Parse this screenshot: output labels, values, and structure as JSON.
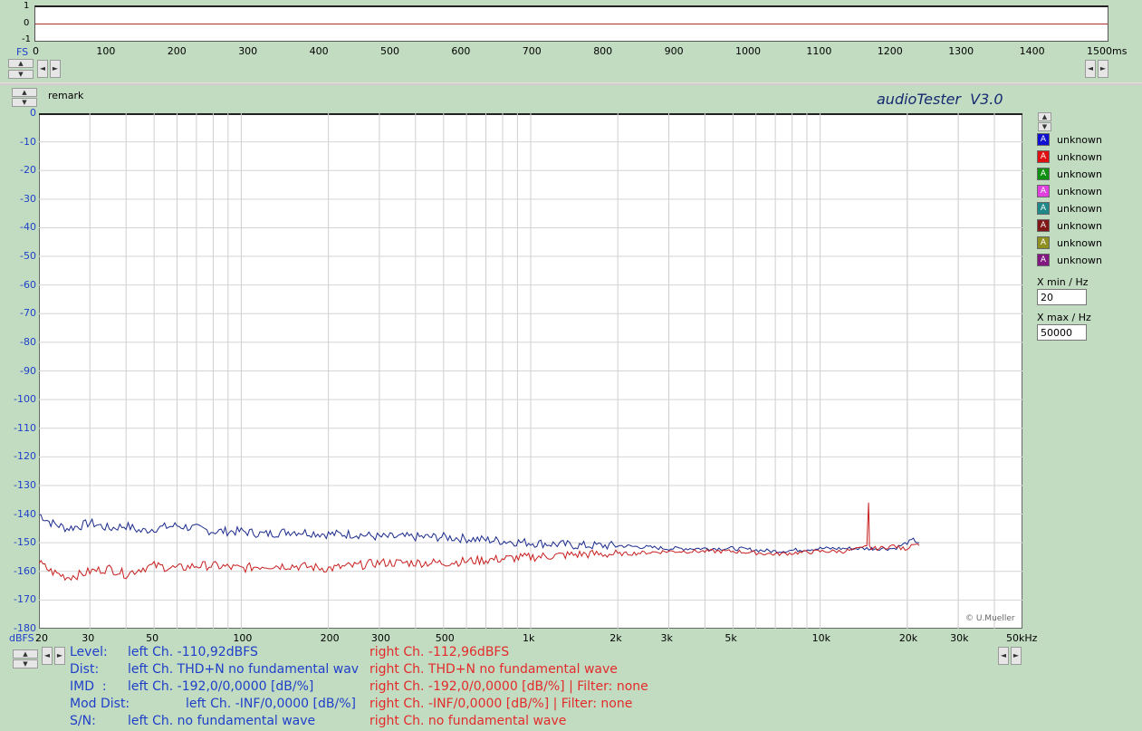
{
  "top_scope": {
    "y_ticks": [
      "1",
      "0",
      "-1"
    ],
    "fs_label": "FS",
    "x_ticks": [
      "0",
      "100",
      "200",
      "300",
      "400",
      "500",
      "600",
      "700",
      "800",
      "900",
      "1000",
      "1100",
      "1200",
      "1300",
      "1400",
      "1500ms"
    ]
  },
  "header": {
    "remark_label": "remark",
    "app_title": "audioTester  V3.0"
  },
  "spectrum": {
    "y_ticks": [
      "0",
      "-10",
      "-20",
      "-30",
      "-40",
      "-50",
      "-60",
      "-70",
      "-80",
      "-90",
      "-100",
      "-110",
      "-120",
      "-130",
      "-140",
      "-150",
      "-160",
      "-170",
      "-180"
    ],
    "y_unit": "dBFS",
    "x_ticks": [
      "20",
      "30",
      "50",
      "100",
      "200",
      "300",
      "500",
      "1k",
      "2k",
      "3k",
      "5k",
      "10k",
      "20k",
      "30k",
      "50kHz"
    ],
    "credit": "© U.Mueller"
  },
  "legend": {
    "items": [
      {
        "label": "unknown",
        "color": "#1010d0"
      },
      {
        "label": "unknown",
        "color": "#e01010"
      },
      {
        "label": "unknown",
        "color": "#109010"
      },
      {
        "label": "unknown",
        "color": "#e040e0"
      },
      {
        "label": "unknown",
        "color": "#208888"
      },
      {
        "label": "unknown",
        "color": "#801818"
      },
      {
        "label": "unknown",
        "color": "#909020"
      },
      {
        "label": "unknown",
        "color": "#801880"
      }
    ],
    "box_glyph": "A"
  },
  "controls": {
    "xmin_label": "X min / Hz",
    "xmin_value": "20",
    "xmax_label": "X max / Hz",
    "xmax_value": "50000"
  },
  "info": {
    "level_label": "Level:",
    "level_left": "left Ch. -110,92dBFS",
    "level_right": "right Ch. -112,96dBFS",
    "dist_label": "Dist:",
    "dist_left": "left Ch. THD+N  no fundamental wave",
    "dist_right": "right Ch. THD+N  no fundamental wave",
    "imd_label": "IMD  :",
    "imd_left": "left Ch. -192,0/0,0000 [dB/%]",
    "imd_right": "right Ch. -192,0/0,0000 [dB/%] |   Filter: none",
    "mod_label": "Mod Dist:",
    "mod_left": "left Ch. -INF/0,0000 [dB/%]",
    "mod_right": "right Ch. -INF/0,0000 [dB/%] |   Filter: none",
    "sn_label": "S/N:",
    "sn_left": "left Ch.  no fundamental wave",
    "sn_right": "right Ch.  no fundamental wave"
  },
  "chart_data": {
    "type": "line",
    "x_scale": "log",
    "xlim": [
      20,
      50000
    ],
    "ylim": [
      -180,
      0
    ],
    "ylabel": "dBFS",
    "grid": true,
    "series": [
      {
        "color": "#1a2a8c",
        "x": [
          20,
          22,
          25,
          28,
          30,
          35,
          40,
          45,
          50,
          60,
          70,
          80,
          100,
          120,
          150,
          200,
          250,
          300,
          400,
          500,
          700,
          1000,
          1500,
          2000,
          3000,
          4000,
          5000,
          7000,
          10000,
          12000,
          14000,
          14500,
          15000,
          15200,
          16000,
          18000,
          19000,
          20000,
          21000,
          22000
        ],
        "y": [
          -140,
          -143,
          -145,
          -144,
          -143,
          -145,
          -144,
          -146,
          -145,
          -144,
          -145,
          -146,
          -146,
          -147,
          -146,
          -147,
          -147,
          -148,
          -148,
          -148,
          -149,
          -150,
          -151,
          -151,
          -152,
          -152,
          -152,
          -153,
          -152,
          -152,
          -152,
          -152,
          -152,
          -152,
          -152,
          -152,
          -151,
          -150,
          -149,
          -150
        ]
      },
      {
        "color": "#c81e1e",
        "x": [
          20,
          22,
          25,
          28,
          30,
          35,
          40,
          45,
          50,
          60,
          70,
          80,
          100,
          120,
          150,
          200,
          250,
          300,
          400,
          500,
          700,
          1000,
          1500,
          2000,
          3000,
          4000,
          5000,
          7000,
          10000,
          12000,
          14000,
          14500,
          14700,
          14800,
          15000,
          16000,
          18000,
          19000,
          20000,
          21000,
          22000
        ],
        "y": [
          -157,
          -160,
          -162,
          -161,
          -160,
          -159,
          -161,
          -159,
          -158,
          -159,
          -158,
          -158,
          -159,
          -158,
          -158,
          -159,
          -158,
          -157,
          -157,
          -157,
          -156,
          -155,
          -154,
          -154,
          -153,
          -153,
          -153,
          -154,
          -153,
          -153,
          -152,
          -151,
          -136,
          -151,
          -152,
          -152,
          -151,
          -152,
          -152,
          -150,
          -151
        ]
      }
    ]
  }
}
